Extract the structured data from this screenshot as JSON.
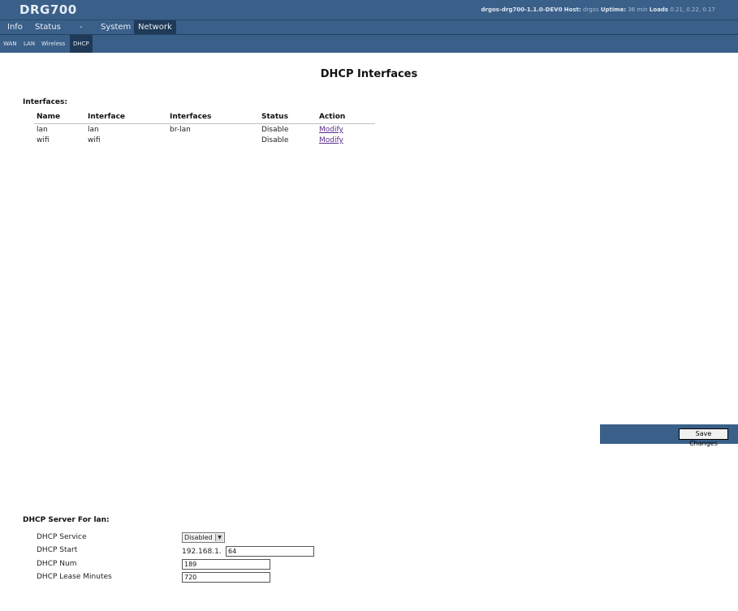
{
  "header": {
    "brand": "DRG700",
    "firmware": "drgos-drg700-1.1.0-DEV0",
    "host_label": "Host:",
    "host_value": "drgos",
    "uptime_label": "Uptime:",
    "uptime_value": "36 min",
    "loads_label": "Loads",
    "loads_value": "0.21, 0.22, 0.17"
  },
  "menu": [
    "Info",
    "Status",
    "-",
    "System",
    "Network"
  ],
  "menu_active": "Network",
  "submenu": [
    "WAN",
    "LAN",
    "Wireless",
    "DHCP"
  ],
  "submenu_active": "DHCP",
  "page_title": "DHCP Interfaces",
  "interfaces": {
    "label": "Interfaces:",
    "columns": [
      "Name",
      "Interface",
      "Interfaces",
      "Status",
      "Action"
    ],
    "rows": [
      {
        "name": "lan",
        "interface": "lan",
        "interfaces": "br-lan",
        "status": "Disable",
        "action": "Modify"
      },
      {
        "name": "wifi",
        "interface": "wifi",
        "interfaces": "",
        "status": "Disable",
        "action": "Modify"
      }
    ]
  },
  "save_label": "Save Changes",
  "dhcp_server": {
    "label": "DHCP Server For lan:",
    "service_label": "DHCP Service",
    "service_value": "Disabled",
    "start_label": "DHCP Start",
    "start_prefix": "192.168.1.",
    "start_value": "64",
    "num_label": "DHCP Num",
    "num_value": "189",
    "lease_label": "DHCP Lease Minutes",
    "lease_value": "720"
  },
  "colors": {
    "header_bg": "#3a5f89",
    "active_tab_bg": "#1f3a58",
    "link": "#5a2a8a"
  }
}
